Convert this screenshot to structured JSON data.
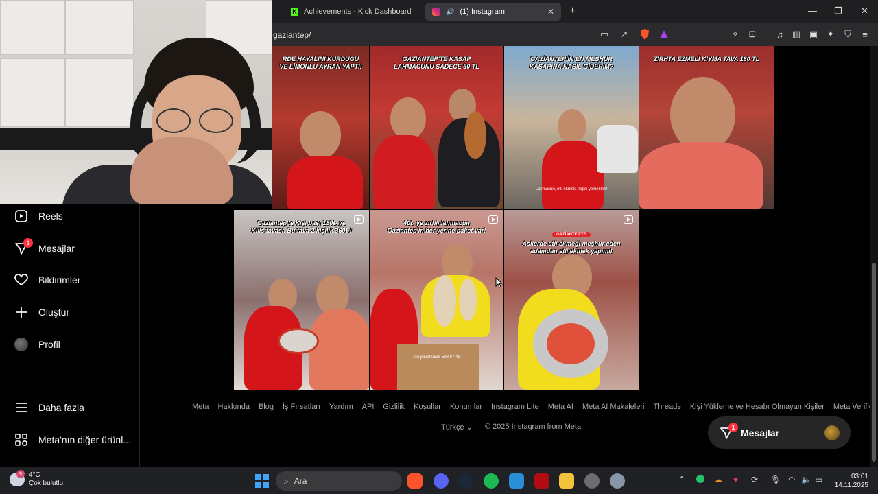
{
  "tabs": [
    {
      "title": "Achievements - Kick Dashboard",
      "favicon": "kick-icon",
      "active": false
    },
    {
      "title": "(1) Instagram",
      "favicon": "instagram-icon",
      "active": true
    }
  ],
  "url": "gaziantep/",
  "sidebar": {
    "items": [
      {
        "label": "Reels",
        "icon": "reels-icon"
      },
      {
        "label": "Mesajlar",
        "icon": "messenger-icon",
        "badge": "1"
      },
      {
        "label": "Bildirimler",
        "icon": "heart-icon"
      },
      {
        "label": "Oluştur",
        "icon": "plus-icon"
      },
      {
        "label": "Profil",
        "icon": "avatar"
      }
    ],
    "more": {
      "label": "Daha fazla",
      "icon": "menu-icon"
    },
    "meta": {
      "label": "Meta'nın diğer ürünl...",
      "icon": "meta-apps-icon"
    }
  },
  "posts": [
    {
      "caption": "RDE HAYALİNİ KURDUĞU\nVE LİMONLU AYRAN YAPTI!",
      "sub": "",
      "reel": false
    },
    {
      "caption": "GAZİANTEP'TE KASAP\nLAHMACUNU SADECE 50 TL",
      "sub": "",
      "reel": false
    },
    {
      "caption": "GAZİANTEP'İN EN MEŞHUR\nKASAPINA NASIL GİDERİM?",
      "sub": "Lahmacun, etli ekmek, Tepsi yemekleri!",
      "reel": false
    },
    {
      "caption": "ZIRHTA EZMELİ KIYMA TAVA 180 TL",
      "sub": "",
      "reel": false
    },
    {
      "caption": "Gaziantep'te Kişi başı 180₺ ye\nKilis tavası, Bu tava 2 kişilik 360₺!",
      "sub": "",
      "reel": true
    },
    {
      "caption": "40₺ ye zırhlı lahmacun\nGaziantep'in her yerine paket var!",
      "sub": "Alo paket 0536 598 07 49",
      "reel": true
    },
    {
      "caption": "Askerde etli ekmeği meşhur eden\nadamdan etli ekmek yapımı!",
      "tag": "GAZİANTEP'TE",
      "sub": "",
      "reel": true
    }
  ],
  "footer": {
    "links": [
      "Meta",
      "Hakkında",
      "Blog",
      "İş Fırsatları",
      "Yardım",
      "API",
      "Gizlilik",
      "Koşullar",
      "Konumlar",
      "Instagram Lite",
      "Meta AI",
      "Meta AI Makaleleri",
      "Threads",
      "Kişi Yükleme ve Hesabı Olmayan Kişiler",
      "Meta Verified"
    ],
    "language": "Türkçe",
    "copyright": "© 2025 Instagram from Meta"
  },
  "floating_messages": {
    "label": "Mesajlar",
    "badge": "1"
  },
  "taskbar": {
    "weather": {
      "temp": "4°C",
      "desc": "Çok bulutlu",
      "badge": "9"
    },
    "search_placeholder": "Ara",
    "time": "03:01",
    "date": "14.11.2025"
  },
  "colors": {
    "accent_red": "#ff3040",
    "background": "#000000",
    "kick_green": "#53fc18"
  }
}
